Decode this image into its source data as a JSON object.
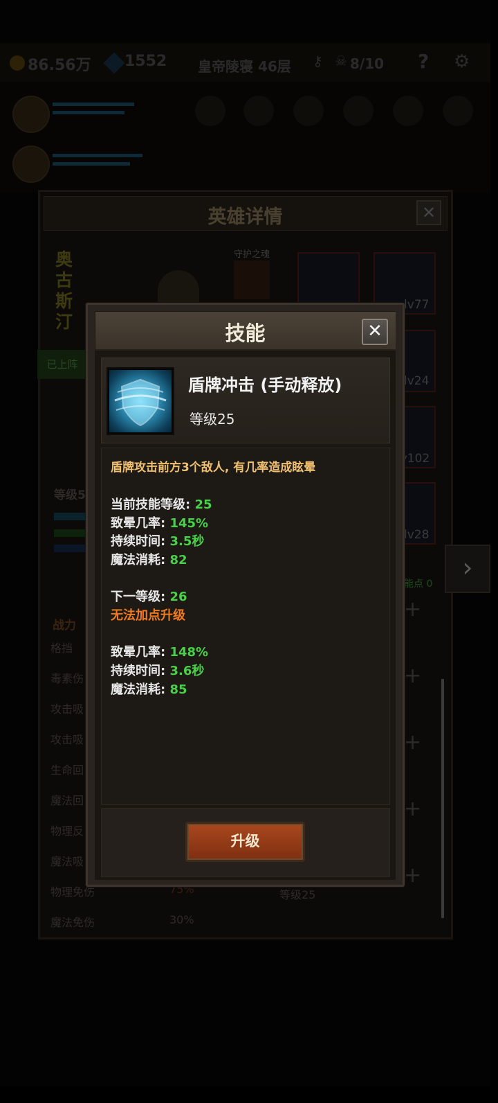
{
  "topbar": {
    "gold": "86.56万",
    "gems": "1552",
    "floor": "皇帝陵寝 46层",
    "keys": "8/10",
    "help": "?"
  },
  "hero_detail": {
    "title": "英雄详情",
    "hero_name": "奥古斯汀",
    "guardian_label": "守护之魂",
    "deployed_label": "已上阵",
    "level_label": "等级5",
    "power_label": "战力",
    "skill_points": "能点 0",
    "equipment": [
      {
        "level": ""
      },
      {
        "level": "lv77"
      },
      {
        "level": "lv24"
      },
      {
        "level": "lv102"
      },
      {
        "level": "lv28"
      }
    ],
    "stats": [
      {
        "label": "格挡",
        "value": ""
      },
      {
        "label": "毒素伤",
        "value": ""
      },
      {
        "label": "攻击吸",
        "value": ""
      },
      {
        "label": "攻击吸",
        "value": ""
      },
      {
        "label": "生命回",
        "value": ""
      },
      {
        "label": "魔法回",
        "value": ""
      },
      {
        "label": "物理反",
        "value": ""
      },
      {
        "label": "魔法吸",
        "value": ""
      },
      {
        "label": "物理免伤",
        "value": "75%"
      },
      {
        "label": "魔法免伤",
        "value": "30%"
      }
    ],
    "skill_row_level": "等级25"
  },
  "skill_modal": {
    "title": "技能",
    "close": "✕",
    "skill_name": "盾牌冲击 (手动释放)",
    "skill_level": "等级25",
    "description": "盾牌攻击前方3个敌人, 有几率造成眩晕",
    "current": {
      "level_label": "当前技能等级: ",
      "level_value": "25",
      "stun_label": "致晕几率: ",
      "stun_value": "145%",
      "duration_label": "持续时间: ",
      "duration_value": "3.5秒",
      "mana_label": "魔法消耗: ",
      "mana_value": "82"
    },
    "next": {
      "level_label": "下一等级: ",
      "level_value": "26",
      "warning": "无法加点升级",
      "stun_label": "致晕几率: ",
      "stun_value": "148%",
      "duration_label": "持续时间: ",
      "duration_value": "3.6秒",
      "mana_label": "魔法消耗: ",
      "mana_value": "85"
    },
    "upgrade_button": "升级"
  },
  "colors": {
    "description": "#f0c070",
    "value_green": "#48d048",
    "warning_orange": "#f07a20",
    "upgrade_button": "#a9481e"
  }
}
